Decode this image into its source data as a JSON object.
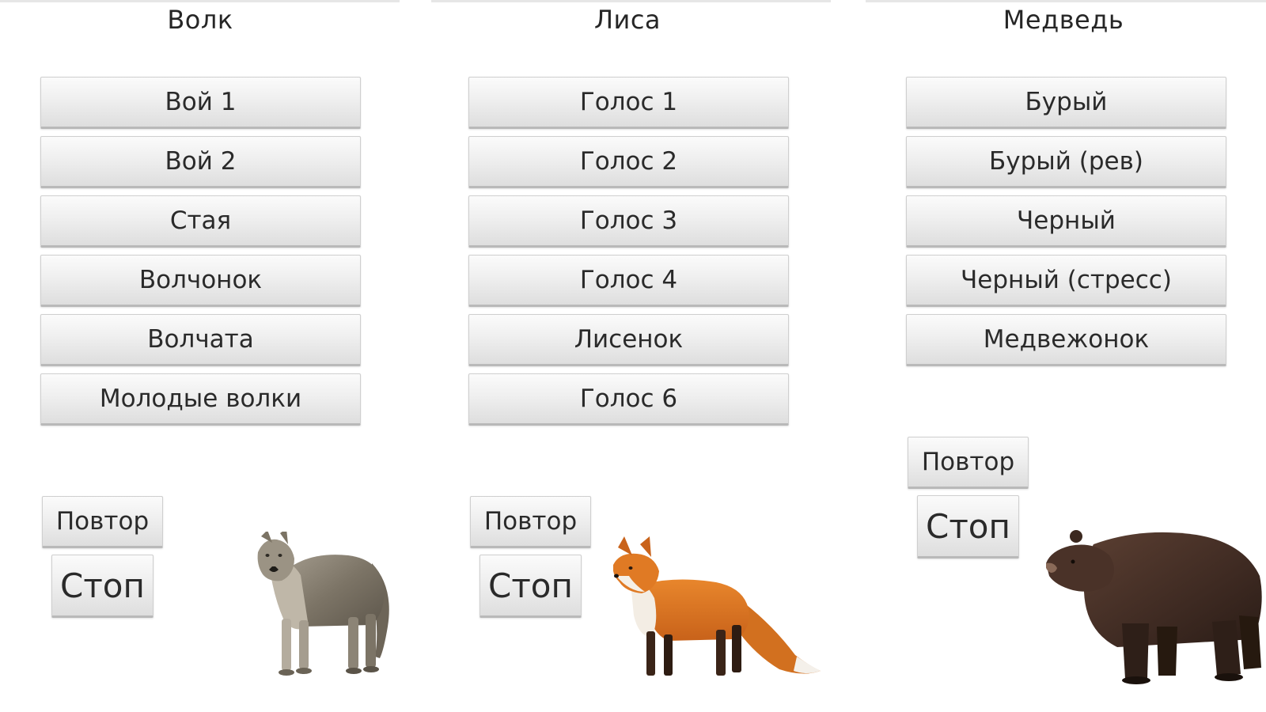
{
  "columns": [
    {
      "title": "Волк",
      "sounds": [
        "Вой 1",
        "Вой 2",
        "Стая",
        "Волчонок",
        "Волчата",
        "Молодые волки"
      ],
      "repeat_label": "Повтор",
      "stop_label": "Стоп",
      "image": "wolf-image"
    },
    {
      "title": "Лиса",
      "sounds": [
        "Голос 1",
        "Голос 2",
        "Голос 3",
        "Голос 4",
        "Лисенок",
        "Голос 6"
      ],
      "repeat_label": "Повтор",
      "stop_label": "Стоп",
      "image": "fox-image"
    },
    {
      "title": "Медведь",
      "sounds": [
        "Бурый",
        "Бурый (рев)",
        "Черный",
        "Черный (стресс)",
        "Медвежонок"
      ],
      "repeat_label": "Повтор",
      "stop_label": "Стоп",
      "image": "bear-image"
    }
  ],
  "colors": {
    "background": "#ffffff",
    "button_top": "#fbfbfb",
    "button_bottom": "#dedede",
    "text": "#2a2a2a"
  }
}
